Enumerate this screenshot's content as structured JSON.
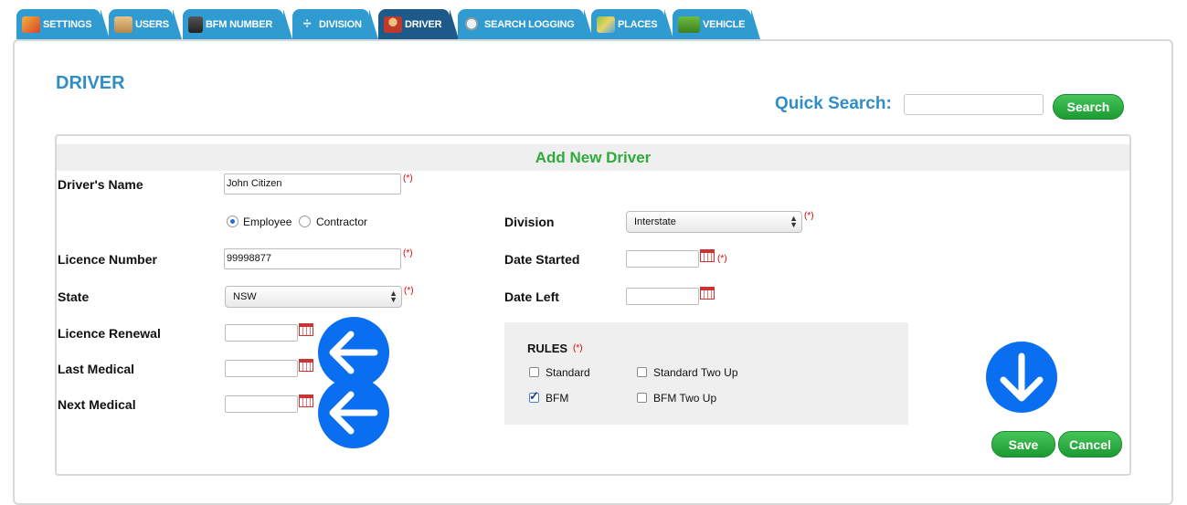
{
  "tabs": [
    {
      "label": "SETTINGS",
      "icon": "settings-icon",
      "active": false
    },
    {
      "label": "USERS",
      "icon": "users-icon",
      "active": false
    },
    {
      "label": "BFM NUMBER",
      "icon": "floppy-disk-icon",
      "active": false
    },
    {
      "label": "DIVISION",
      "icon": "division-icon",
      "active": false
    },
    {
      "label": "DRIVER",
      "icon": "driver-icon",
      "active": true
    },
    {
      "label": "SEARCH LOGGING",
      "icon": "magnifier-icon",
      "active": false
    },
    {
      "label": "PLACES",
      "icon": "map-icon",
      "active": false
    },
    {
      "label": "VEHICLE",
      "icon": "truck-icon",
      "active": false
    }
  ],
  "page": {
    "title": "DRIVER"
  },
  "search": {
    "label": "Quick Search:",
    "value": "",
    "button": "Search"
  },
  "form": {
    "heading": "Add New Driver",
    "required_mark": "(*)",
    "drivers_name": {
      "label": "Driver's Name",
      "value": "John Citizen"
    },
    "employment": {
      "options": [
        "Employee",
        "Contractor"
      ],
      "selected": "Employee"
    },
    "licence_number": {
      "label": "Licence Number",
      "value": "99998877"
    },
    "state": {
      "label": "State",
      "value": "NSW"
    },
    "licence_renewal": {
      "label": "Licence Renewal",
      "value": ""
    },
    "last_medical": {
      "label": "Last Medical",
      "value": ""
    },
    "next_medical": {
      "label": "Next Medical",
      "value": ""
    },
    "division": {
      "label": "Division",
      "value": "Interstate"
    },
    "date_started": {
      "label": "Date Started",
      "value": ""
    },
    "date_left": {
      "label": "Date Left",
      "value": ""
    },
    "rules": {
      "label": "RULES",
      "options": [
        {
          "label": "Standard",
          "checked": false
        },
        {
          "label": "Standard Two Up",
          "checked": false
        },
        {
          "label": "BFM",
          "checked": true
        },
        {
          "label": "BFM Two Up",
          "checked": false
        }
      ]
    },
    "save": "Save",
    "cancel": "Cancel"
  },
  "colors": {
    "tab": "#2f9bd0",
    "tab_active": "#1d5a8a",
    "title": "#2f8fc4",
    "green": "#2eaa3c",
    "arrow": "#0a6ef0"
  }
}
